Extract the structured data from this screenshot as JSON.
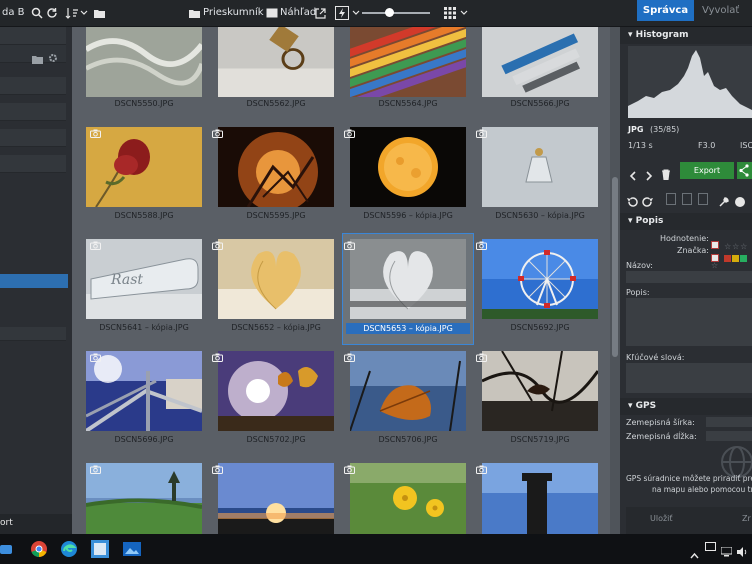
{
  "toolbar": {
    "left_label": "da B",
    "mode_prieskumnik": "Prieskumník",
    "mode_nahlad": "Náhľad",
    "tab_spravca": "Správca",
    "tab_vyvolat": "Vyvolať"
  },
  "left_panel": {
    "footer": "ort"
  },
  "grid": {
    "thumbnails": [
      {
        "name": "DSCN5550.JPG"
      },
      {
        "name": "DSCN5562.JPG"
      },
      {
        "name": "DSCN5564.JPG"
      },
      {
        "name": "DSCN5566.JPG"
      },
      {
        "name": "DSCN5588.JPG"
      },
      {
        "name": "DSCN5595.JPG"
      },
      {
        "name": "DSCN5596 – kópia.JPG"
      },
      {
        "name": "DSCN5630 – kópia.JPG"
      },
      {
        "name": "DSCN5641 – kópia.JPG"
      },
      {
        "name": "DSCN5652 – kópia.JPG"
      },
      {
        "name": "DSCN5653 – kópia.JPG"
      },
      {
        "name": "DSCN5692.JPG"
      },
      {
        "name": "DSCN5696.JPG"
      },
      {
        "name": "DSCN5702.JPG"
      },
      {
        "name": "DSCN5706.JPG"
      },
      {
        "name": "DSCN5719.JPG"
      },
      {
        "name": ""
      },
      {
        "name": ""
      },
      {
        "name": ""
      },
      {
        "name": ""
      }
    ],
    "selected_name": "DSCN5653 – kópia.JPG"
  },
  "right_panel": {
    "histogram_title": "Histogram",
    "file_type": "JPG",
    "counter": "(35/85)",
    "shutter": "1/13 s",
    "aperture": "F3.0",
    "iso": "ISO",
    "export_label": "Export",
    "popis_title": "Popis",
    "hodnotenie_label": "Hodnotenie:",
    "znacka_label": "Značka:",
    "nazov_label": "Názov:",
    "popis_label": "Popis:",
    "klucove_label": "Kľúčové slová:",
    "gps_title": "GPS",
    "lat_label": "Zemepisná šírka:",
    "lon_label": "Zemepisná dĺžka:",
    "gps_hint_1": "GPS súradnice môžete priradiť pretia",
    "gps_hint_2": "na mapu alebo pomocou tra",
    "ulozit": "Uložiť",
    "zrusit": "Zr"
  },
  "colors": {
    "accent": "#1f6fc3",
    "export_green": "#2e8b3a",
    "grid_bg": "#5a5f66",
    "selection": "#2a6ebd"
  },
  "icons": [
    "search-icon",
    "refresh-icon",
    "sort-icon",
    "folder-icon",
    "external-icon",
    "filter-icon",
    "grid-view-icon",
    "camera-icon",
    "arrow-left-icon",
    "arrow-right-icon",
    "trash-icon",
    "rotate-left-icon",
    "rotate-right-icon",
    "share-icon",
    "globe-icon",
    "chrome-icon",
    "edge-icon",
    "windows-icon"
  ]
}
